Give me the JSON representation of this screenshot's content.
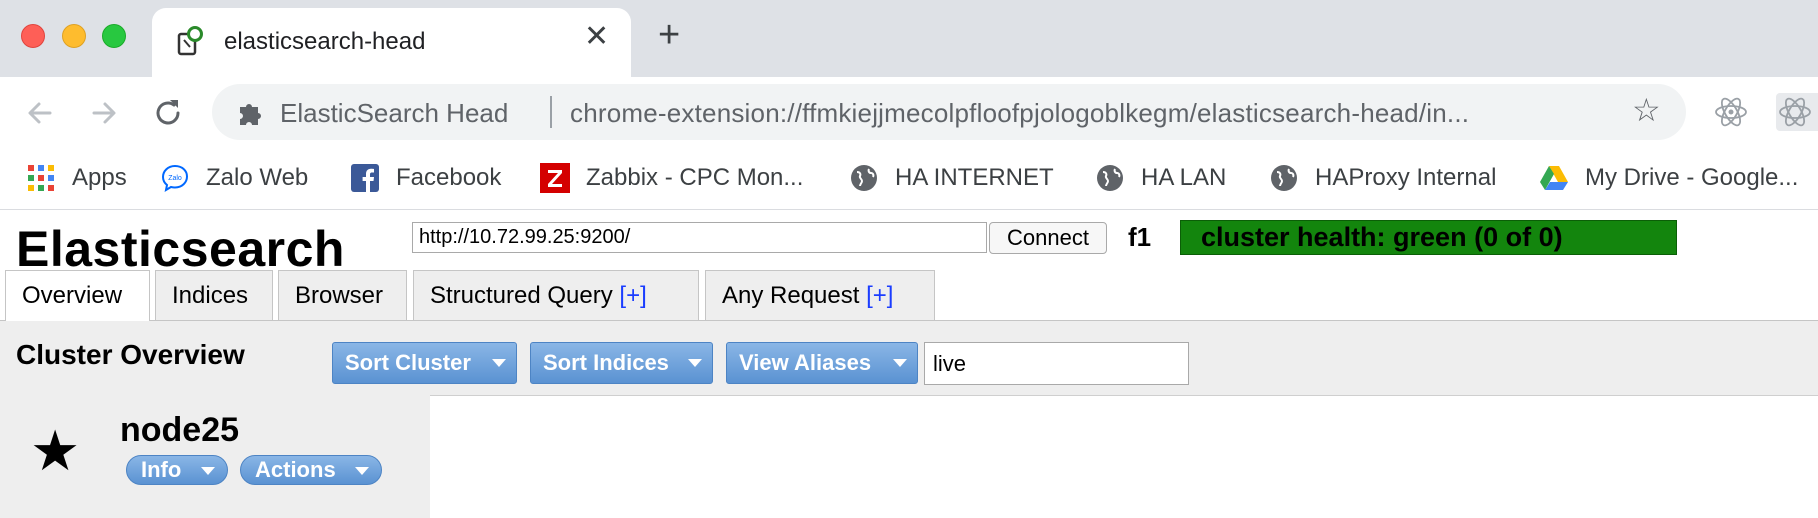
{
  "browser": {
    "tab_title": "elasticsearch-head",
    "tab_close": "✕",
    "new_tab": "+",
    "omnibox_site": "ElasticSearch Head",
    "omnibox_url": "chrome-extension://ffmkiejjmecolpfloofpjologoblkegm/elasticsearch-head/in...",
    "bookmarks": [
      {
        "label": "Apps",
        "icon": "apps-grid-icon"
      },
      {
        "label": "Zalo Web",
        "icon": "zalo-icon"
      },
      {
        "label": "Facebook",
        "icon": "facebook-icon"
      },
      {
        "label": "Zabbix - CPC Mon...",
        "icon": "zabbix-icon"
      },
      {
        "label": "HA INTERNET",
        "icon": "globe-icon"
      },
      {
        "label": "HA LAN",
        "icon": "globe-icon"
      },
      {
        "label": "HAProxy Internal",
        "icon": "globe-icon"
      },
      {
        "label": "My Drive - Google...",
        "icon": "google-drive-icon"
      }
    ]
  },
  "app": {
    "title": "Elasticsearch",
    "connect_url": "http://10.72.99.25:9200/",
    "connect_label": "Connect",
    "cluster_name": "f1",
    "cluster_health": "cluster health: green (0 of 0)",
    "health_color": "#13850d",
    "tabs": [
      {
        "label": "Overview",
        "plus": "",
        "active": true
      },
      {
        "label": "Indices",
        "plus": ""
      },
      {
        "label": "Browser",
        "plus": ""
      },
      {
        "label": "Structured Query ",
        "plus": "[+]"
      },
      {
        "label": "Any Request ",
        "plus": "[+]"
      }
    ]
  },
  "overview": {
    "title": "Cluster Overview",
    "buttons": [
      "Sort Cluster",
      "Sort Indices",
      "View Aliases"
    ],
    "filter_value": "live"
  },
  "node": {
    "name": "node25",
    "master_icon": "star-icon",
    "buttons": [
      "Info",
      "Actions"
    ]
  }
}
